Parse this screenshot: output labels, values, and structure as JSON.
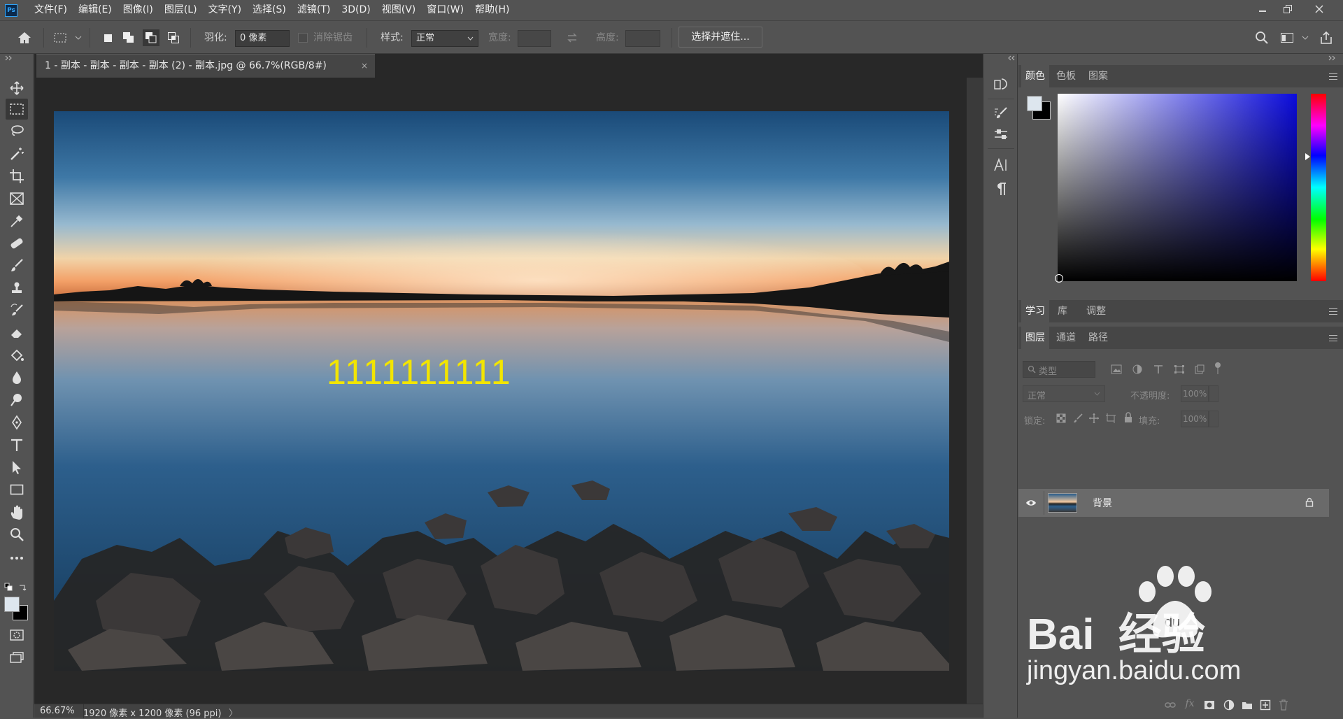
{
  "app": {
    "logo_text": "Ps"
  },
  "menu": [
    "文件(F)",
    "编辑(E)",
    "图像(I)",
    "图层(L)",
    "文字(Y)",
    "选择(S)",
    "滤镜(T)",
    "3D(D)",
    "视图(V)",
    "窗口(W)",
    "帮助(H)"
  ],
  "options": {
    "feather_label": "羽化:",
    "feather_value": "0 像素",
    "antialias_label": "消除锯齿",
    "style_label": "样式:",
    "style_value": "正常",
    "width_label": "宽度:",
    "height_label": "高度:",
    "select_mask_button": "选择并遮住..."
  },
  "document": {
    "tab_title": "1 - 副本 - 副本 - 副本 - 副本 (2) - 副本.jpg @ 66.7%(RGB/8#)",
    "tab_close": "×",
    "canvas_text": "1111111111",
    "canvas_text_color": "#f2e500"
  },
  "status": {
    "zoom": "66.67%",
    "doc_info": "1920 像素 x 1200 像素 (96 ppi)",
    "arrow": "〉"
  },
  "panels": {
    "color_tabs": [
      "颜色",
      "色板",
      "图案"
    ],
    "learn_tabs": [
      "学习",
      "库",
      "调整"
    ],
    "layer_tabs": [
      "图层",
      "通道",
      "路径"
    ],
    "filter_placeholder": "类型",
    "blend_mode": "正常",
    "opacity_label": "不透明度:",
    "opacity_value": "100%",
    "lock_label": "锁定:",
    "fill_label": "填充:",
    "fill_value": "100%",
    "layer_name": "背景"
  },
  "watermark": {
    "brand": "Bai  经验",
    "url": "jingyan.baidu.com"
  },
  "colors": {
    "ui_bg": "#535353",
    "canvas_bg": "#282828",
    "accent_text": "#f2e500"
  }
}
